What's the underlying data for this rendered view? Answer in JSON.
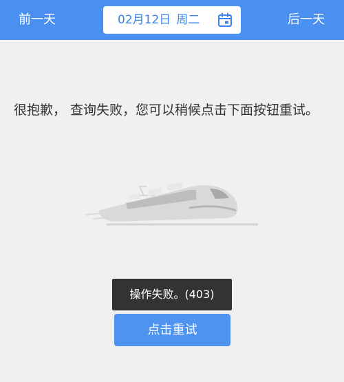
{
  "header": {
    "prev_day_label": "前一天",
    "next_day_label": "后一天",
    "date": "02月12日",
    "weekday": "周二",
    "calendar_icon": "calendar-icon",
    "colors": {
      "bar": "#4a90f0",
      "date_text": "#3a82ec"
    }
  },
  "error": {
    "message": "很抱歉， 查询失败，您可以稍候点击下面按钮重试。",
    "illustration_icon": "train-icon"
  },
  "toast": {
    "text": "操作失败。(403)"
  },
  "retry_button": {
    "label": "点击重试",
    "color": "#4f93f0"
  }
}
